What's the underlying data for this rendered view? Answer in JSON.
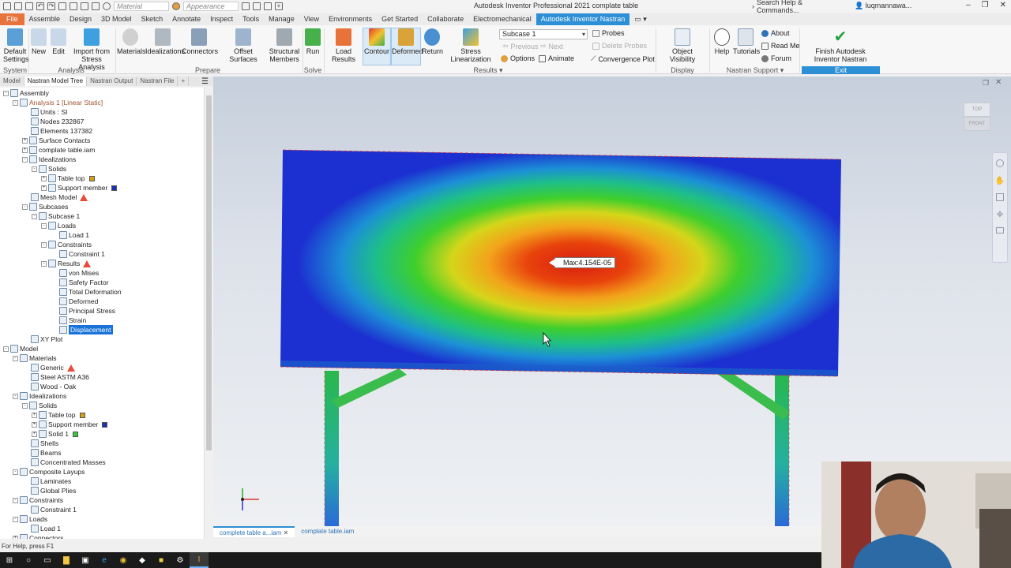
{
  "titlebar": {
    "material_placeholder": "Material",
    "appearance_placeholder": "Appearance",
    "title": "Autodesk Inventor Professional 2021    complate table",
    "search": "Search Help & Commands...",
    "user": "luqmannawa..."
  },
  "tabs": [
    "File",
    "Assemble",
    "Design",
    "3D Model",
    "Sketch",
    "Annotate",
    "Inspect",
    "Tools",
    "Manage",
    "View",
    "Environments",
    "Get Started",
    "Collaborate",
    "Electromechanical",
    "Autodesk Inventor Nastran"
  ],
  "ribbon": {
    "buttons": {
      "default_settings": "Default Settings",
      "new": "New",
      "edit": "Edit",
      "import_from": "Import from Stress Analysis",
      "materials": "Materials",
      "idealizations": "Idealizations",
      "connectors": "Connectors",
      "offset_surfaces": "Offset Surfaces",
      "structural_members": "Structural Members",
      "run": "Run",
      "load_results": "Load Results",
      "contour": "Contour",
      "deformed": "Deformed",
      "return": "Return",
      "stress_linearization": "Stress Linearization",
      "object_visibility": "Object Visibility",
      "help": "Help",
      "tutorials": "Tutorials",
      "finish": "Finish Autodesk Inventor Nastran"
    },
    "subcase_select": "Subcase 1",
    "small": {
      "probes": "Probes",
      "previous": "Previous",
      "next": "Next",
      "delete_probes": "Delete Probes",
      "options": "Options",
      "animate": "Animate",
      "convergence_plot": "Convergence Plot",
      "about": "About",
      "read_me": "Read Me",
      "forum": "Forum"
    },
    "groups": {
      "system": "System",
      "analysis": "Analysis",
      "prepare": "Prepare",
      "solve": "Solve",
      "results": "Results",
      "display": "Display",
      "nastran_support": "Nastran Support",
      "exit": "Exit"
    }
  },
  "panel_tabs": [
    "Model",
    "Nastran Model Tree",
    "Nastran Output",
    "Nastran File"
  ],
  "tree": [
    {
      "label": "Assembly",
      "level": 0,
      "toggle": "-"
    },
    {
      "label": "Analysis 1 [Linear Static]",
      "level": 1,
      "toggle": "-",
      "color": "#a0522d"
    },
    {
      "label": "Units : SI",
      "level": 2
    },
    {
      "label": "Nodes 232867",
      "level": 2
    },
    {
      "label": "Elements 137382",
      "level": 2
    },
    {
      "label": "Surface Contacts",
      "level": 2,
      "toggle": "+"
    },
    {
      "label": "complate table.iam",
      "level": 2,
      "toggle": "+"
    },
    {
      "label": "Idealizations",
      "level": 2,
      "toggle": "-"
    },
    {
      "label": "Solids",
      "level": 3,
      "toggle": "-"
    },
    {
      "label": "Table top",
      "level": 4,
      "toggle": "+",
      "swatch": "#d4a017"
    },
    {
      "label": "Support member",
      "level": 4,
      "toggle": "+",
      "swatch": "#1c2fb5"
    },
    {
      "label": "Mesh Model",
      "level": 2,
      "warn": true
    },
    {
      "label": "Subcases",
      "level": 2,
      "toggle": "-"
    },
    {
      "label": "Subcase 1",
      "level": 3,
      "toggle": "-"
    },
    {
      "label": "Loads",
      "level": 4,
      "toggle": "-"
    },
    {
      "label": "Load 1",
      "level": 5
    },
    {
      "label": "Constraints",
      "level": 4,
      "toggle": "-"
    },
    {
      "label": "Constraint 1",
      "level": 5
    },
    {
      "label": "Results",
      "level": 4,
      "toggle": "-",
      "warn": true
    },
    {
      "label": "von Mises",
      "level": 5
    },
    {
      "label": "Safety Factor",
      "level": 5
    },
    {
      "label": "Total Deformation",
      "level": 5
    },
    {
      "label": "Deformed",
      "level": 5
    },
    {
      "label": "Principal Stress",
      "level": 5
    },
    {
      "label": "Strain",
      "level": 5
    },
    {
      "label": "Displacement",
      "level": 5,
      "selected": true
    },
    {
      "label": "XY Plot",
      "level": 2
    },
    {
      "label": "Model",
      "level": 0,
      "toggle": "-"
    },
    {
      "label": "Materials",
      "level": 1,
      "toggle": "-"
    },
    {
      "label": "Generic",
      "level": 2,
      "warn": true
    },
    {
      "label": "Steel ASTM A36",
      "level": 2
    },
    {
      "label": "Wood - Oak",
      "level": 2
    },
    {
      "label": "Idealizations",
      "level": 1,
      "toggle": "-"
    },
    {
      "label": "Solids",
      "level": 2,
      "toggle": "-"
    },
    {
      "label": "Table top",
      "level": 3,
      "toggle": "+",
      "swatch": "#d4a017"
    },
    {
      "label": "Support member",
      "level": 3,
      "toggle": "+",
      "swatch": "#1c2fb5"
    },
    {
      "label": "Solid 1",
      "level": 3,
      "toggle": "+",
      "swatch": "#3cc43c"
    },
    {
      "label": "Shells",
      "level": 2
    },
    {
      "label": "Beams",
      "level": 2
    },
    {
      "label": "Concentrated Masses",
      "level": 2
    },
    {
      "label": "Composite Layups",
      "level": 1,
      "toggle": "-"
    },
    {
      "label": "Laminates",
      "level": 2
    },
    {
      "label": "Global Plies",
      "level": 2
    },
    {
      "label": "Constraints",
      "level": 1,
      "toggle": "-"
    },
    {
      "label": "Constraint 1",
      "level": 2
    },
    {
      "label": "Loads",
      "level": 1,
      "toggle": "-"
    },
    {
      "label": "Load 1",
      "level": 2
    },
    {
      "label": "Connectors",
      "level": 1,
      "toggle": "+"
    }
  ],
  "viewport": {
    "max_label": "Max:4.154E-05",
    "viewcube_top": "TOP",
    "viewcube_front": "FRONT"
  },
  "doc_tabs": [
    "complete table a...iam",
    "complate table.iam"
  ],
  "status": "For Help, press F1",
  "colors": {
    "accent": "#2d8fd5",
    "file_tab": "#e8743b"
  }
}
